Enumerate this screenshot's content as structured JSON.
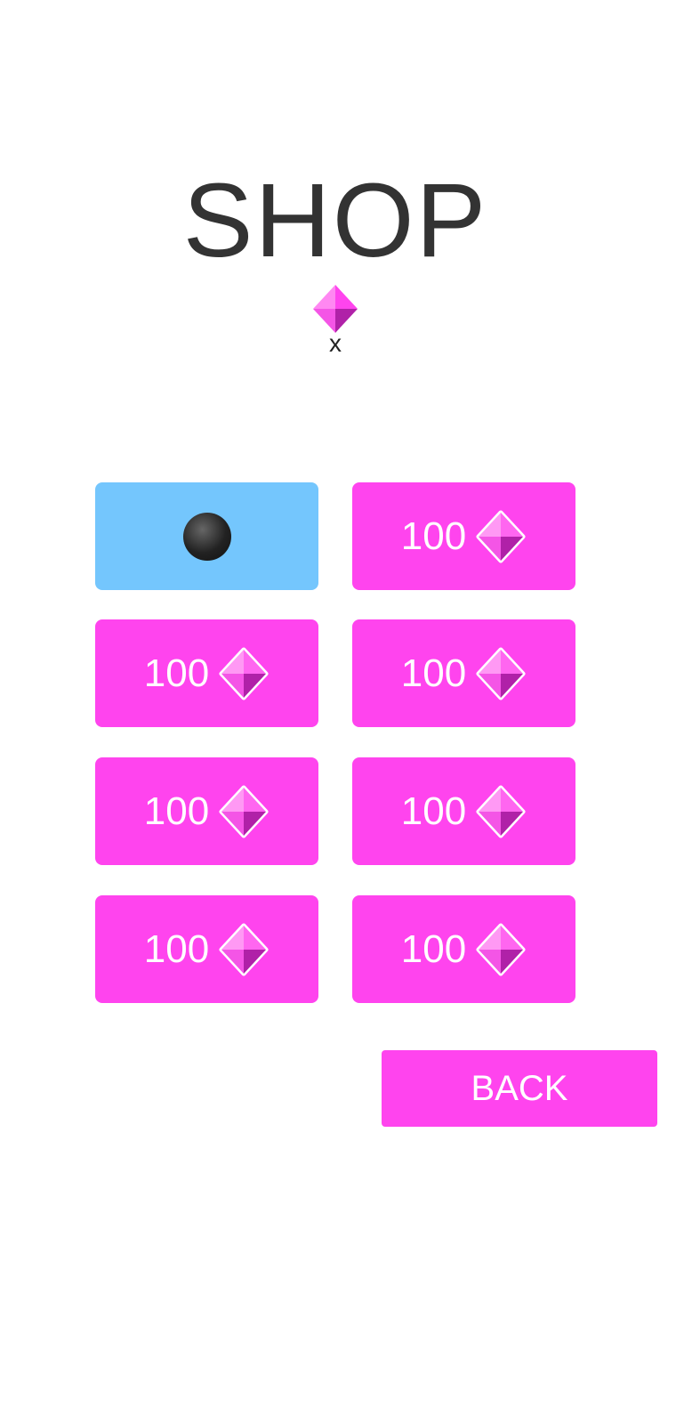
{
  "title": "SHOP",
  "gem_count": "x",
  "colors": {
    "accent": "#ff44ee",
    "selected": "#74c6fd"
  },
  "items": [
    {
      "type": "ball",
      "selected": true
    },
    {
      "price": "100"
    },
    {
      "price": "100"
    },
    {
      "price": "100"
    },
    {
      "price": "100"
    },
    {
      "price": "100"
    },
    {
      "price": "100"
    },
    {
      "price": "100"
    }
  ],
  "back_label": "BACK"
}
